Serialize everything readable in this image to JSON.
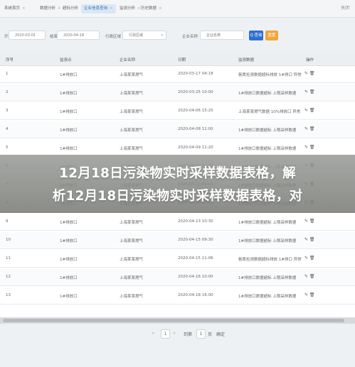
{
  "tabs": [
    {
      "label": "系统首页"
    },
    {
      "label": "数据分析"
    },
    {
      "label": "超标分析"
    },
    {
      "label": "企业信息查询"
    },
    {
      "label": "监测分析"
    },
    {
      "label": "历史数据"
    }
  ],
  "corner_label": "关闭",
  "filter": {
    "start_label": "开始时间",
    "start_value": "2020-03-01",
    "end_label": "结束时间",
    "end_value": "2020-04-18",
    "district_label": "行政区域",
    "district_placeholder": "行政区域",
    "company_label": "企业名称",
    "company_placeholder": "企业名称",
    "query_label": "Q 查询",
    "reset_label": "重置"
  },
  "table": {
    "headers": [
      "序号",
      "监测点",
      "企业名称",
      "日期",
      "监测数据",
      "操作"
    ],
    "rows": [
      {
        "no": "1",
        "point": "1#排放口",
        "company": "上海某某燃气",
        "date": "2020-03-17 04:18",
        "data": "氨氮检测数据超标排放 1#排口   异常"
      },
      {
        "no": "2",
        "point": "1#排放口",
        "company": "上海某某燃气",
        "date": "2020-03-25 10:00",
        "data": "1#排放口数据超标 上限采样数据"
      },
      {
        "no": "3",
        "point": "1#排放口",
        "company": "上海某某燃气",
        "date": "2020-04-06 15:25",
        "data": "上海某某燃气数据 10%排放口 异常"
      },
      {
        "no": "4",
        "point": "1#排放口",
        "company": "上海某某燃气",
        "date": "2020-04-08 11:00",
        "data": "1#排放口数据超标 上限采样数据"
      },
      {
        "no": "5",
        "point": "1#排放口",
        "company": "上海某某燃气",
        "date": "2020-04-09 11:20",
        "data": "1#排放口数据超标 上限采样数据"
      },
      {
        "no": "6",
        "point": "1#排放口",
        "company": "上海某某燃气",
        "date": "2020-04-09 11:20",
        "data": "1#排放口数据超标 上限采样数据"
      },
      {
        "no": "7",
        "point": "1#排放口",
        "company": "上海某某燃气",
        "date": "2020-04-10 09:00",
        "data": "1#排放口数据超标 上限采样数据"
      },
      {
        "no": "8",
        "point": "1#排放口",
        "company": "上海某某燃气",
        "date": "2020-04-10 10:20",
        "data": "1#排放口数据超标 上限采样数据"
      },
      {
        "no": "9",
        "point": "1#排放口",
        "company": "上海某某燃气",
        "date": "2020-04-13 10:30",
        "data": "1#排放口数据超标 上限采样数据"
      },
      {
        "no": "10",
        "point": "1#排放口",
        "company": "上海某某燃气",
        "date": "2020-04-15 09:30",
        "data": "1#排放口数据超标 上限采样数据"
      },
      {
        "no": "11",
        "point": "1#排放口",
        "company": "上海某某燃气",
        "date": "2020-04-15 11:06",
        "data": "氨氮检测数据超标排放 1#排口   异常"
      },
      {
        "no": "12",
        "point": "1#排放口",
        "company": "上海某某燃气",
        "date": "2020-04-16 10:00",
        "data": "1#排放口数据超标 上限采样数据"
      },
      {
        "no": "13",
        "point": "1#排放口",
        "company": "上海某某燃气",
        "date": "2020-04-18 16:00",
        "data": "1#排放口数据超标 上限采样数据"
      }
    ],
    "row_ops": "✎ 🗑"
  },
  "overlay": {
    "line1": "12月18日污染物实时采样数据表格，解",
    "line2": "析12月18日污染物实时采样数据表格，对"
  },
  "pager": {
    "prev": "‹",
    "page": "1",
    "next": "›",
    "goto_label": "到第",
    "goto_value": "1",
    "page_unit": "页",
    "confirm": "确定"
  }
}
